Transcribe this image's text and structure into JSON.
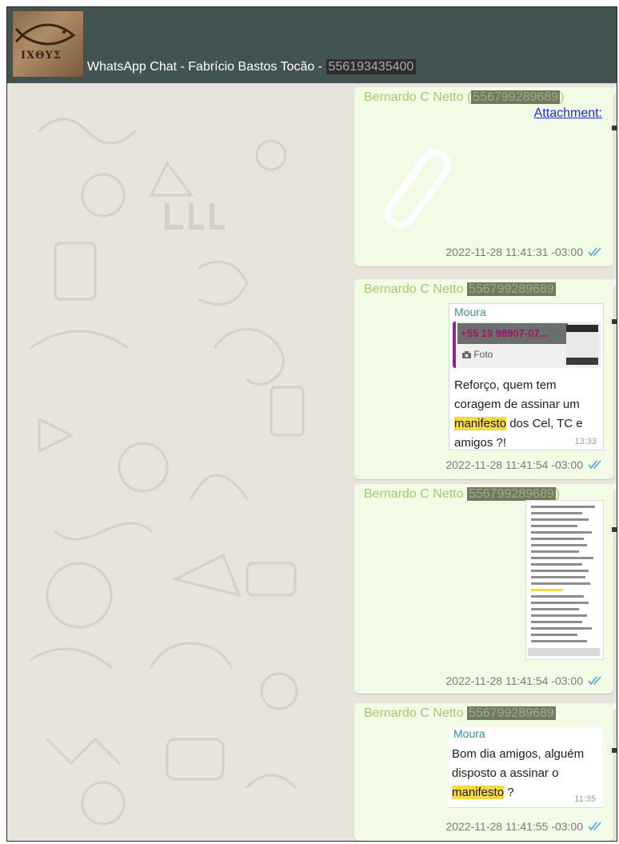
{
  "header": {
    "logo_text": "IXΘYΣ",
    "title": "WhatsApp Chat - Fabrício Bastos Tocão - ",
    "phone": "556193435400"
  },
  "messages": [
    {
      "sender": "Bernardo C Netto",
      "phone": "556799289689",
      "attachment_label": "Attachment:",
      "timestamp": "2022-11-28 11:41:31 -03:00"
    },
    {
      "sender": "Bernardo C Netto",
      "phone": "556799289689",
      "quoted": {
        "author": "Moura",
        "reply_phone": "+55 19 98907-07...",
        "reply_type": "Foto",
        "text_before": "Reforço, quem tem coragem de assinar um ",
        "highlight": "manifesto",
        "text_after": " dos Cel, TC e amigos ?!",
        "time": "13:33"
      },
      "timestamp": "2022-11-28 11:41:54 -03:00"
    },
    {
      "sender": "Bernardo C Netto",
      "phone": "556799289689",
      "timestamp": "2022-11-28 11:41:54 -03:00"
    },
    {
      "sender": "Bernardo C Netto",
      "phone": "556799289689",
      "quoted": {
        "author": "Moura",
        "text_before": "Bom dia amigos, alguém disposto a assinar o ",
        "highlight": "manifesto",
        "text_after": " ?",
        "time": "11:35"
      },
      "timestamp": "2022-11-28 11:41:55 -03:00"
    }
  ],
  "colors": {
    "header_bg": "#435352",
    "bubble_bg": "#f1fbe6",
    "sender": "#a9c86a",
    "tick": "#4fa3e3",
    "highlight": "#f6d84a"
  },
  "icons": [
    "paperclip-icon",
    "double-check-icon",
    "camera-icon"
  ]
}
